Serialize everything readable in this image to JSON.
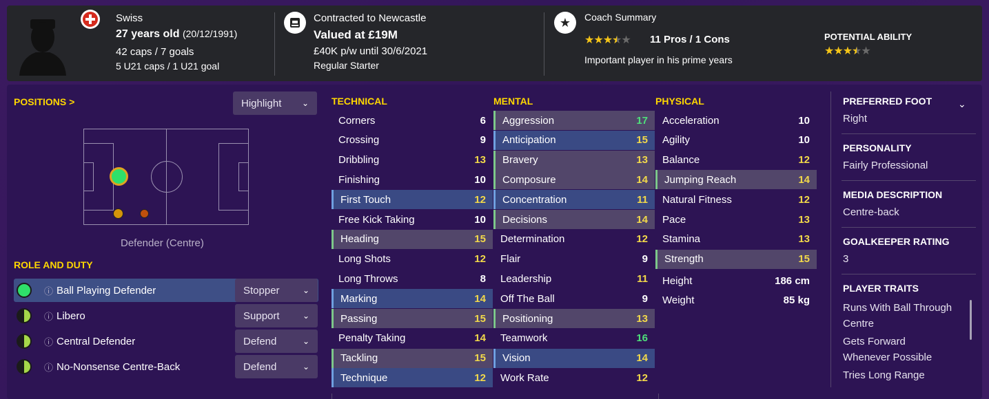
{
  "header": {
    "nationality": "Swiss",
    "age": "27 years old",
    "dob": "(20/12/1991)",
    "caps": "42 caps / 7 goals",
    "u21": "5 U21 caps / 1 U21 goal",
    "contract_title": "Contracted to Newcastle",
    "value": "Valued at £19M",
    "wage": "£40K p/w until 30/6/2021",
    "squad_status": "Regular Starter",
    "coach_title": "Coach Summary",
    "pros_cons": "11 Pros / 1 Cons",
    "coach_comment": "Important player in his prime years",
    "potential_label": "POTENTIAL ABILITY",
    "current_stars": 3.5,
    "potential_stars": 3.5
  },
  "positions": {
    "title": "POSITIONS >",
    "highlight_label": "Highlight",
    "position_name": "Defender (Centre)"
  },
  "roles": {
    "title": "ROLE AND DUTY",
    "items": [
      {
        "name": "Ball Playing Defender",
        "duty": "Stopper"
      },
      {
        "name": "Libero",
        "duty": "Support"
      },
      {
        "name": "Central Defender",
        "duty": "Defend"
      },
      {
        "name": "No-Nonsense Centre-Back",
        "duty": "Defend"
      }
    ]
  },
  "technical": {
    "title": "TECHNICAL",
    "items": [
      {
        "name": "Corners",
        "value": "6"
      },
      {
        "name": "Crossing",
        "value": "9"
      },
      {
        "name": "Dribbling",
        "value": "13"
      },
      {
        "name": "Finishing",
        "value": "10"
      },
      {
        "name": "First Touch",
        "value": "12"
      },
      {
        "name": "Free Kick Taking",
        "value": "10"
      },
      {
        "name": "Heading",
        "value": "15"
      },
      {
        "name": "Long Shots",
        "value": "12"
      },
      {
        "name": "Long Throws",
        "value": "8"
      },
      {
        "name": "Marking",
        "value": "14"
      },
      {
        "name": "Passing",
        "value": "15"
      },
      {
        "name": "Penalty Taking",
        "value": "14"
      },
      {
        "name": "Tackling",
        "value": "15"
      },
      {
        "name": "Technique",
        "value": "12"
      }
    ]
  },
  "mental": {
    "title": "MENTAL",
    "items": [
      {
        "name": "Aggression",
        "value": "17"
      },
      {
        "name": "Anticipation",
        "value": "15"
      },
      {
        "name": "Bravery",
        "value": "13"
      },
      {
        "name": "Composure",
        "value": "14"
      },
      {
        "name": "Concentration",
        "value": "11"
      },
      {
        "name": "Decisions",
        "value": "14"
      },
      {
        "name": "Determination",
        "value": "12"
      },
      {
        "name": "Flair",
        "value": "9"
      },
      {
        "name": "Leadership",
        "value": "11"
      },
      {
        "name": "Off The Ball",
        "value": "9"
      },
      {
        "name": "Positioning",
        "value": "13"
      },
      {
        "name": "Teamwork",
        "value": "16"
      },
      {
        "name": "Vision",
        "value": "14"
      },
      {
        "name": "Work Rate",
        "value": "12"
      }
    ]
  },
  "physical": {
    "title": "PHYSICAL",
    "items": [
      {
        "name": "Acceleration",
        "value": "10"
      },
      {
        "name": "Agility",
        "value": "10"
      },
      {
        "name": "Balance",
        "value": "12"
      },
      {
        "name": "Jumping Reach",
        "value": "14"
      },
      {
        "name": "Natural Fitness",
        "value": "12"
      },
      {
        "name": "Pace",
        "value": "13"
      },
      {
        "name": "Stamina",
        "value": "13"
      },
      {
        "name": "Strength",
        "value": "15"
      }
    ],
    "height_label": "Height",
    "height_value": "186 cm",
    "weight_label": "Weight",
    "weight_value": "85 kg"
  },
  "info": {
    "foot_title": "PREFERRED FOOT",
    "foot_value": "Right",
    "personality_title": "PERSONALITY",
    "personality_value": "Fairly Professional",
    "media_title": "MEDIA DESCRIPTION",
    "media_value": "Centre-back",
    "gk_title": "GOALKEEPER RATING",
    "gk_value": "3",
    "traits_title": "PLAYER TRAITS",
    "traits": [
      "Runs With Ball Through",
      "Centre",
      "Gets Forward",
      "Whenever Possible",
      "Tries Long Range"
    ]
  },
  "colors": {
    "accent_yellow": "#ffd700",
    "value_green": "#4ee07a",
    "value_yellow": "#f2d94a",
    "panel_bg": "#2d1454"
  }
}
